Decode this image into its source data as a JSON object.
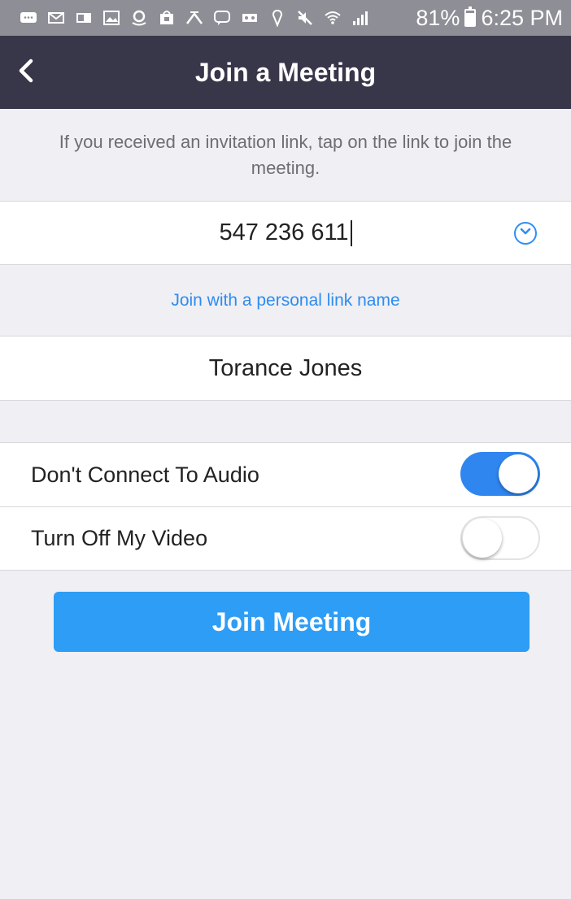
{
  "status_bar": {
    "icons": [
      "message-icon",
      "mail-icon",
      "outlook-icon",
      "gallery-icon",
      "amazon-icon",
      "store-icon",
      "transit-icon",
      "chat-icon",
      "voicemail-icon",
      "location-icon",
      "mute-icon",
      "wifi-icon",
      "signal-icon"
    ],
    "battery": "81%",
    "battery_level": 0.81,
    "time": "6:25 PM"
  },
  "header": {
    "title": "Join a Meeting",
    "back_icon": "chevron-left-icon"
  },
  "hint": {
    "text": "If you received an invitation link, tap on the link to join the meeting."
  },
  "meeting_id": {
    "value": "547 236 611",
    "dropdown_icon": "chevron-down-circle-icon"
  },
  "personal_link": {
    "label": "Join with a personal link name"
  },
  "name": {
    "value": "Torance Jones"
  },
  "options": [
    {
      "label": "Don't Connect To Audio",
      "enabled": true
    },
    {
      "label": "Turn Off My Video",
      "enabled": false
    }
  ],
  "join_button": {
    "label": "Join Meeting"
  },
  "colors": {
    "status_bar": "#8e8e96",
    "nav_bar": "#383649",
    "background": "#efeff4",
    "accent": "#2d9df6",
    "link": "#2d8cf0",
    "toggle_on": "#2f86ef"
  }
}
